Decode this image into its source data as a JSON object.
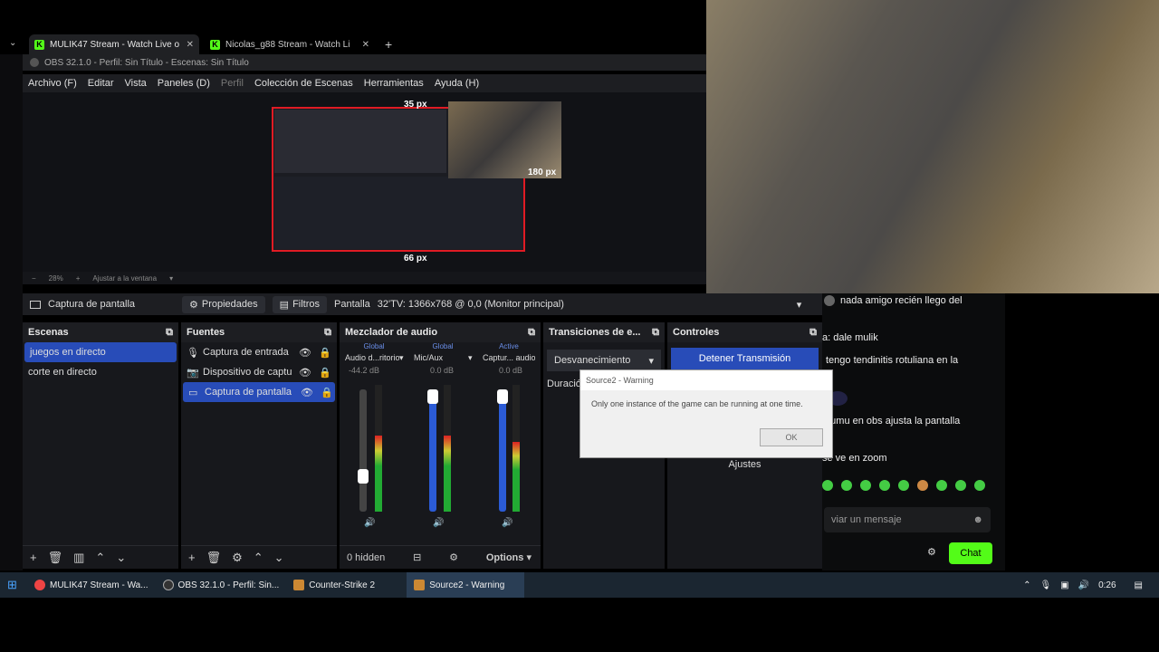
{
  "browser_tabs": [
    {
      "title": "MULIK47 Stream - Watch Live o",
      "active": true
    },
    {
      "title": "Nicolas_g88 Stream - Watch Li",
      "active": false
    }
  ],
  "obs": {
    "title": "OBS 32.1.0 - Perfil: Sin Título - Escenas: Sin Título",
    "menu": [
      "Archivo (F)",
      "Editar",
      "Vista",
      "Paneles (D)",
      "Perfil",
      "Colección de Escenas",
      "Herramientas",
      "Ayuda (H)"
    ],
    "preview_labels": {
      "top": "35 px",
      "right": "180 px",
      "bottom": "66 px"
    },
    "zoom": {
      "value": "28%",
      "label": "Ajustar a la ventana"
    },
    "source_bar": {
      "name": "Captura de pantalla",
      "props": "Propiedades",
      "filters": "Filtros",
      "display_label": "Pantalla",
      "display_value": "32'TV: 1366x768 @ 0,0 (Monitor principal)"
    },
    "scenes": {
      "title": "Escenas",
      "items": [
        "juegos en directo",
        "corte en directo"
      ],
      "selected": 0
    },
    "sources": {
      "title": "Fuentes",
      "items": [
        "Captura de entrada",
        "Dispositivo de captu",
        "Captura de pantalla"
      ],
      "selected": 2
    },
    "mixer": {
      "title": "Mezclador de audio",
      "tags": [
        "Global",
        "Global",
        "Active"
      ],
      "channels": [
        {
          "name": "Audio d...ritorio",
          "db": "-44.2 dB",
          "level": 0.35
        },
        {
          "name": "Mic/Aux",
          "db": "0.0 dB",
          "level": 0.5
        },
        {
          "name": "Captur... audio",
          "db": "0.0 dB",
          "level": 0.45
        }
      ],
      "scale": [
        "0",
        "-6",
        "-12",
        "-18",
        "-24",
        "-30",
        "-36",
        "-42",
        "-48",
        "-54",
        "-60"
      ],
      "footer_hidden": "0 hidden",
      "options": "Options"
    },
    "transitions": {
      "title": "Transiciones de e...",
      "value": "Desvanecimiento",
      "duration_label": "Duración"
    },
    "controls": {
      "title": "Controles",
      "stop": "Detener Transmisión",
      "settings": "Ajustes"
    }
  },
  "dialog": {
    "title": "Source2 - Warning",
    "message": "Only one instance of the game can be running at one time.",
    "ok": "OK"
  },
  "chat": {
    "messages": [
      {
        "text": "nada amigo recién llego del"
      },
      {
        "text": "a: dale mulik"
      },
      {
        "text": "tengo tendinitis rotuliana en la"
      },
      {
        "text": "mumu en obs ajusta la pantalla"
      },
      {
        "text": "se ve en zoom"
      }
    ],
    "placeholder": "viar un mensaje",
    "send": "Chat"
  },
  "taskbar": {
    "items": [
      {
        "label": "MULIK47 Stream - Wa...",
        "active": false
      },
      {
        "label": "OBS 32.1.0 - Perfil: Sin...",
        "active": false
      },
      {
        "label": "Counter-Strike 2",
        "active": false
      },
      {
        "label": "Source2 - Warning",
        "active": true
      }
    ],
    "time": "0:26"
  }
}
